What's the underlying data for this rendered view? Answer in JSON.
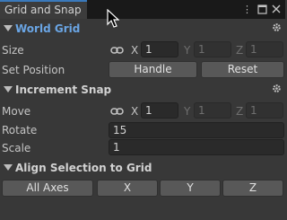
{
  "tab": {
    "title": "Grid and Snap",
    "menu_glyph": "⋮",
    "maximize_glyph": "□",
    "close_glyph": "✕"
  },
  "world_grid": {
    "title": "World Grid",
    "size_label": "Size",
    "axes": {
      "x": "X",
      "y": "Y",
      "z": "Z"
    },
    "size": {
      "x": "1",
      "y": "1",
      "z": "1"
    },
    "set_position_label": "Set Position",
    "handle_button": "Handle",
    "reset_button": "Reset"
  },
  "increment_snap": {
    "title": "Increment Snap",
    "move_label": "Move",
    "axes": {
      "x": "X",
      "y": "Y",
      "z": "Z"
    },
    "move": {
      "x": "1",
      "y": "1",
      "z": "1"
    },
    "rotate_label": "Rotate",
    "rotate_value": "15",
    "scale_label": "Scale",
    "scale_value": "1"
  },
  "align": {
    "title": "Align Selection to Grid",
    "all_axes": "All Axes",
    "x": "X",
    "y": "Y",
    "z": "Z"
  },
  "colors": {
    "accent": "#3a79bb",
    "section_blue": "#6aa5e4",
    "panel_bg": "#383838"
  }
}
